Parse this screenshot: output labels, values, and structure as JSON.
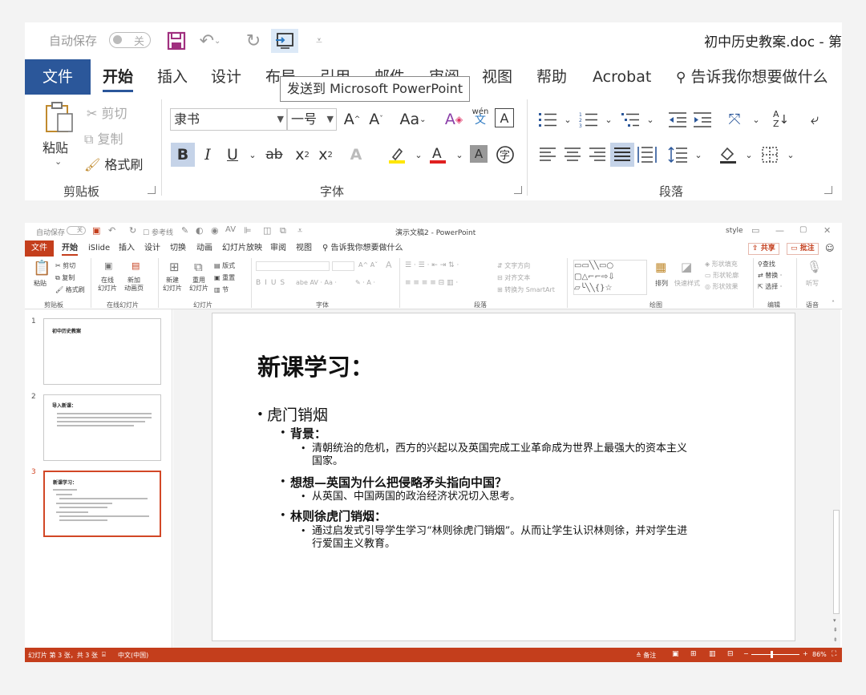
{
  "word": {
    "autosave_label": "自动保存",
    "autosave_state": "关",
    "doc_title": "初中历史教案.doc - 第",
    "tabs": [
      "文件",
      "开始",
      "插入",
      "设计",
      "布局",
      "引用",
      "邮件",
      "审阅",
      "视图",
      "帮助",
      "Acrobat"
    ],
    "tell_me": "告诉我你想要做什么",
    "tooltip": "发送到 Microsoft PowerPoint",
    "clipboard": {
      "paste": "粘贴",
      "cut": "剪切",
      "copy": "复制",
      "format_painter": "格式刷",
      "group": "剪贴板"
    },
    "font": {
      "name": "隶书",
      "size": "一号",
      "group": "字体",
      "change_case": "Aa",
      "phonetic": "wén"
    },
    "paragraph": {
      "group": "段落"
    }
  },
  "ppt": {
    "autosave_label": "自动保存",
    "autosave_state": "关",
    "ruler_label": "参考线",
    "title": "演示文稿2 - PowerPoint",
    "style_label": "style",
    "tabs": [
      "文件",
      "开始",
      "iSlide",
      "插入",
      "设计",
      "切换",
      "动画",
      "幻灯片放映",
      "审阅",
      "视图"
    ],
    "tell_me": "告诉我你想要做什么",
    "share": "共享",
    "comment": "批注",
    "ribbon": {
      "paste": "粘贴",
      "cut": "剪切",
      "copy": "复制",
      "format_painter": "格式刷",
      "clipboard_group": "剪贴板",
      "online_slides": "在线\n幻灯片",
      "new_animation": "新加\n动画页",
      "online_group": "在线幻灯片",
      "new_slide": "新建\n幻灯片",
      "reuse_slide": "重用\n幻灯片",
      "layout": "版式",
      "reset": "重置",
      "section": "节",
      "slides_group": "幻灯片",
      "font_group": "字体",
      "text_direction": "文字方向",
      "align_text": "对齐文本",
      "smartart": "转换为 SmartArt",
      "paragraph_group": "段落",
      "arrange": "排列",
      "quick_styles": "快速样式",
      "shape_fill": "形状填充",
      "shape_outline": "形状轮廓",
      "shape_effects": "形状效果",
      "drawing_group": "绘图",
      "find": "查找",
      "replace": "替换",
      "select": "选择",
      "editing_group": "编辑",
      "dictate": "听写",
      "voice_group": "语音"
    },
    "thumbnails": [
      {
        "num": "1",
        "title": "初中历史教案"
      },
      {
        "num": "2",
        "title": "导入新课："
      },
      {
        "num": "3",
        "title": "新课学习："
      }
    ],
    "slide": {
      "title": "新课学习：",
      "l1": "虎门销烟",
      "bg_head": "背景：",
      "bg_text_1": "清朝统治的危机，西方的兴起以及英国完成工业革命成为世界上最强大的资本主义",
      "bg_text_2": "国家。",
      "think_head": "想想—英国为什么把侵略矛头指向中国？",
      "think_text": "从英国、中国两国的政治经济状况切入思考。",
      "lin_head": "林则徐虎门销烟：",
      "lin_text_1": "通过启发式引导学生学习“林则徐虎门销烟”。从而让学生认识林则徐，并对学生进",
      "lin_text_2": "行爱国主义教育。"
    },
    "status": {
      "slide_info": "幻灯片 第 3 张，共 3 张",
      "language": "中文(中国)",
      "notes": "备注",
      "zoom": "86%"
    }
  }
}
